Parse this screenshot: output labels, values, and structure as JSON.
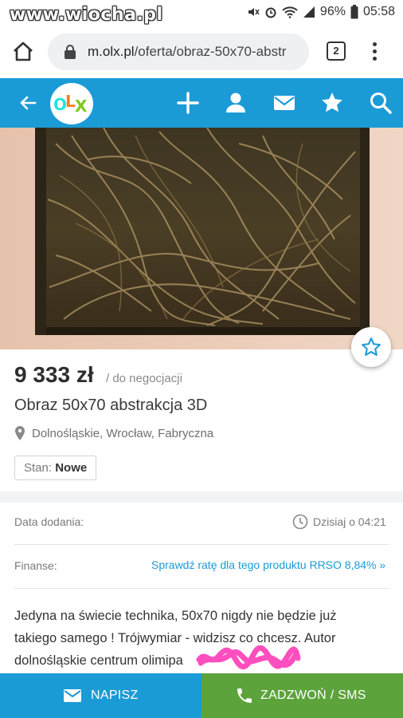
{
  "status_bar": {
    "watermark": "www.wiocha.pl",
    "battery": "96%",
    "time": "05:58"
  },
  "browser": {
    "url_domain": "m.olx.pl",
    "url_path": "/oferta/obraz-50x70-abstr",
    "tab_count": "2"
  },
  "header": {
    "logo_text": [
      "O",
      "L",
      "X"
    ],
    "logo_colors": [
      "#23e5db",
      "#f97d1b",
      "#7ec91b"
    ],
    "bar_color": "#1b9bd6",
    "icons": [
      "back-arrow-icon",
      "plus-icon",
      "user-icon",
      "mail-icon",
      "star-icon",
      "search-icon"
    ]
  },
  "listing": {
    "price": "9 333 zł",
    "price_note": "/ do negocjacji",
    "title": "Obraz 50x70 abstrakcja 3D",
    "location": "Dolnośląskie, Wrocław, Fabryczna",
    "condition_label": "Stan:",
    "condition_value": "Nowe"
  },
  "details": {
    "added_label": "Data dodania:",
    "added_value": "Dzisiaj o 04:21",
    "finance_label": "Finanse:",
    "finance_link": "Sprawdź ratę dla tego produktu RRSO 8,84% »"
  },
  "description": {
    "line1": "Jedyna na świecie technika, 50x70 nigdy nie będzie już",
    "line2": "takiego samego ! Trójwymiar - widzisz co chcesz. Autor",
    "line3": "dolnośląskie centrum olimipa"
  },
  "actions": {
    "write_label": "NAPISZ",
    "call_label": "ZADZWOŃ / SMS",
    "write_color": "#1b9bd6",
    "call_color": "#5ca33c"
  }
}
